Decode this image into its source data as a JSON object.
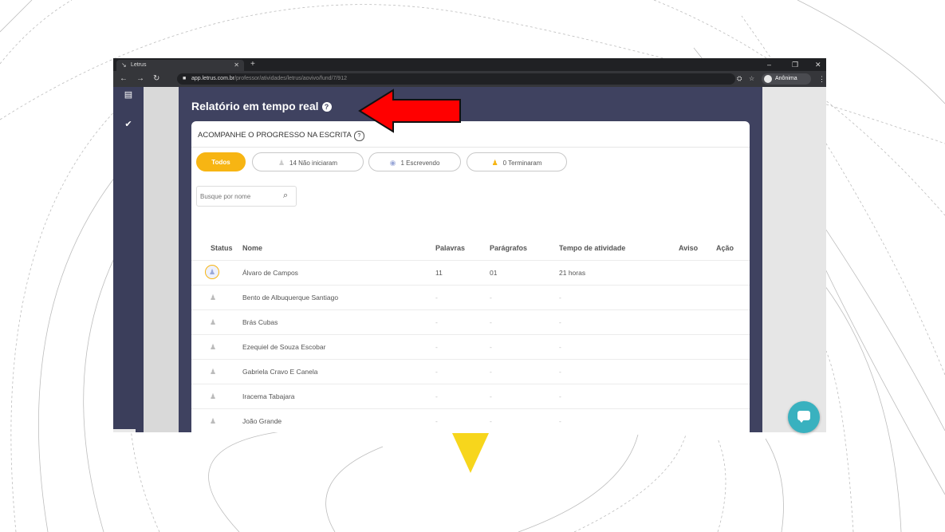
{
  "browser": {
    "tab_title": "Letrus",
    "url_host": "app.letrus.com.br",
    "url_path": "/professor/atividades/letrus/aovivo/fund/7",
    "url_tail": "912",
    "profile_name": "Anônima"
  },
  "page": {
    "title": "Relatório em tempo real",
    "card_title": "ACOMPANHE O PROGRESSO NA ESCRITA"
  },
  "filters": [
    {
      "label": "Todos",
      "active": true
    },
    {
      "label": "14 Não iniciaram",
      "active": false
    },
    {
      "label": "1 Escrevendo",
      "active": false
    },
    {
      "label": "0 Terminaram",
      "active": false
    }
  ],
  "search": {
    "placeholder": "Busque por nome"
  },
  "table": {
    "headers": [
      "Status",
      "Nome",
      "Palavras",
      "Parágrafos",
      "Tempo de atividade",
      "Aviso",
      "Ação"
    ],
    "rows": [
      {
        "status": "Escrevendo",
        "nome": "Álvaro de Campos",
        "palavras": "11",
        "paragrafos": "01",
        "tempo": "21 horas"
      },
      {
        "status": "Não iniciou",
        "nome": "Bento de Albuquerque Santiago",
        "palavras": "-",
        "paragrafos": "-",
        "tempo": "-"
      },
      {
        "status": "Não iniciou",
        "nome": "Brás Cubas",
        "palavras": "-",
        "paragrafos": "-",
        "tempo": "-"
      },
      {
        "status": "Não iniciou",
        "nome": "Ezequiel de Souza Escobar",
        "palavras": "-",
        "paragrafos": "-",
        "tempo": "-"
      },
      {
        "status": "Não iniciou",
        "nome": "Gabriela Cravo E Canela",
        "palavras": "-",
        "paragrafos": "-",
        "tempo": "-"
      },
      {
        "status": "Não iniciou",
        "nome": "Iracema Tabajara",
        "palavras": "-",
        "paragrafos": "-",
        "tempo": "-"
      },
      {
        "status": "Não iniciou",
        "nome": "João Grande",
        "palavras": "-",
        "paragrafos": "-",
        "tempo": "-"
      }
    ]
  },
  "colors": {
    "accent_yellow": "#f7b513",
    "sidebar_navy": "#3b3e5b",
    "content_bg": "#3f4260",
    "annotation_red": "#ff0000",
    "chat_teal": "#39b1bf"
  },
  "icons": {
    "sidebar": [
      "list-icon",
      "clipboard-check-icon"
    ],
    "status_writing": "user-circle-icon",
    "status_not_started": "user-icon",
    "search": "search-icon",
    "chat": "chat-bubble-icon"
  }
}
